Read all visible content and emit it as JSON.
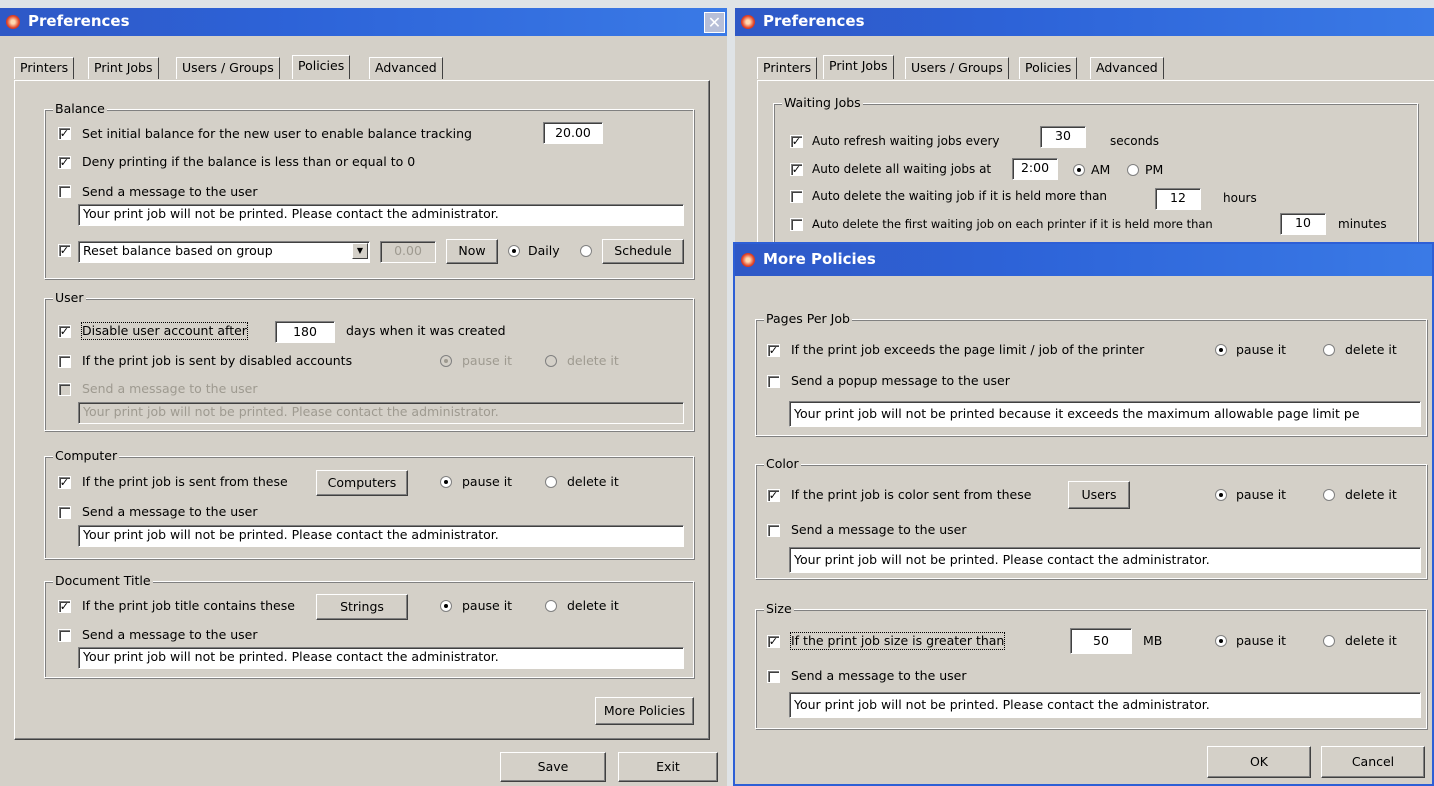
{
  "left_window": {
    "title": "Preferences",
    "tabs": [
      "Printers",
      "Print Jobs",
      "Users / Groups",
      "Policies",
      "Advanced"
    ],
    "active_tab": "Policies",
    "balance": {
      "group_title": "Balance",
      "initial_label": "Set initial balance for the new user to enable balance tracking",
      "initial_value": "20.00",
      "deny_label": "Deny printing if the balance is less than or equal to 0",
      "send_msg_label": "Send a message to the user",
      "message": "Your print job will not be printed.  Please contact the administrator.",
      "reset_option": "Reset balance based on group",
      "reset_value": "0.00",
      "now_label": "Now",
      "daily_label": "Daily",
      "schedule_label": "Schedule"
    },
    "user": {
      "group_title": "User",
      "disable_label": "Disable user account after",
      "disable_days": "180",
      "days_suffix": "days when it was created",
      "disabled_accounts_label": "If the print job is sent by disabled accounts",
      "pause_label": "pause it",
      "delete_label": "delete it",
      "send_msg_label": "Send a message to the user",
      "message": "Your print job will not be printed.  Please contact the administrator."
    },
    "computer": {
      "group_title": "Computer",
      "sent_from_label": "If the print job is sent from  these",
      "computers_button": "Computers",
      "pause_label": "pause it",
      "delete_label": "delete it",
      "send_msg_label": "Send a message to the user",
      "message": "Your print job will not be printed.  Please contact the administrator."
    },
    "document_title": {
      "group_title": "Document Title",
      "contains_label": "If the print job title contains these",
      "strings_button": "Strings",
      "pause_label": "pause it",
      "delete_label": "delete it",
      "send_msg_label": "Send a message to the user",
      "message": "Your print job will not be printed.  Please contact the administrator."
    },
    "more_policies_button": "More Policies",
    "save_button": "Save",
    "exit_button": "Exit"
  },
  "right_window": {
    "title": "Preferences",
    "tabs": [
      "Printers",
      "Print Jobs",
      "Users / Groups",
      "Policies",
      "Advanced"
    ],
    "active_tab": "Print Jobs",
    "waiting_jobs": {
      "group_title": "Waiting Jobs",
      "refresh_label": "Auto refresh waiting jobs every",
      "refresh_value": "30",
      "refresh_suffix": "seconds",
      "delete_all_label": "Auto delete all waiting jobs at",
      "delete_all_time": "2:00",
      "am_label": "AM",
      "pm_label": "PM",
      "delete_held_label": "Auto delete the waiting job if it is held more than",
      "delete_held_value": "12",
      "delete_held_suffix": "hours",
      "delete_first_label": "Auto delete the first waiting job on each printer if it is held more than",
      "delete_first_value": "10",
      "delete_first_suffix": "minutes"
    }
  },
  "dialog": {
    "title": "More Policies",
    "pages_per_job": {
      "group_title": "Pages Per Job",
      "exceeds_label": "If the print job exceeds the page limit / job of the printer",
      "pause_label": "pause it",
      "delete_label": "delete it",
      "popup_label": "Send a popup message to the user",
      "message": "Your print job will not be printed because it exceeds the maximum allowable page limit pe"
    },
    "color": {
      "group_title": "Color",
      "color_label": "If the print job is color sent from these",
      "users_button": "Users",
      "pause_label": "pause it",
      "delete_label": "delete it",
      "send_msg_label": "Send a message to the user",
      "message": "Your print job will not be printed.  Please contact the administrator."
    },
    "size": {
      "group_title": "Size",
      "size_label": "If the print job size is greater than",
      "size_value": "50",
      "unit": "MB",
      "pause_label": "pause it",
      "delete_label": "delete it",
      "send_msg_label": "Send a message to the user",
      "message": "Your print job will not be printed.  Please contact the administrator."
    },
    "ok_button": "OK",
    "cancel_button": "Cancel"
  }
}
